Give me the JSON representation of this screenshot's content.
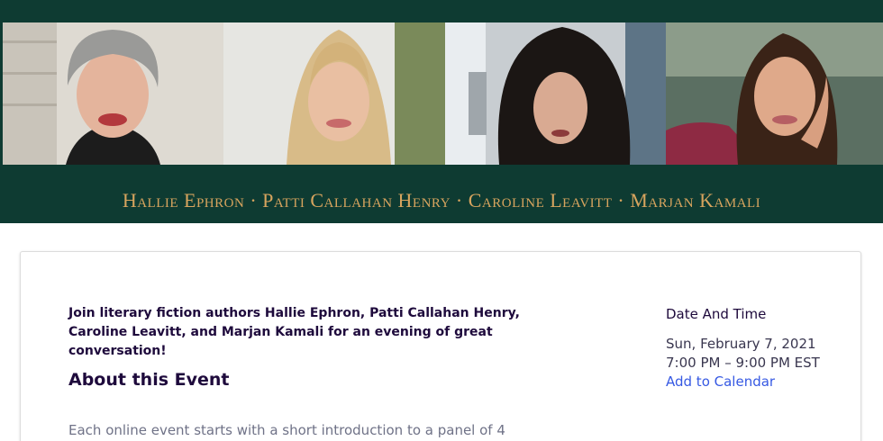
{
  "banner": {
    "authors_line": "Hallie Ephron · Patti Callahan Henry · Caroline Leavitt · Marjan Kamali",
    "colors": {
      "background": "#0e3b32",
      "text": "#d7a45e"
    }
  },
  "event": {
    "summary": "Join literary fiction authors Hallie Ephron, Patti Callahan Henry, Caroline Leavitt, and Marjan Kamali for an evening of great conversation!",
    "about_heading": "About this Event",
    "about_body": "Each online event starts with a short introduction to a panel of 4"
  },
  "date_time": {
    "heading": "Date And Time",
    "date": "Sun, February 7, 2021",
    "time": "7:00 PM – 9:00 PM EST",
    "add_to_calendar": "Add to Calendar"
  },
  "colors": {
    "link": "#3659e3",
    "heading_text": "#1e0a3c",
    "body_text": "#6f7287"
  }
}
